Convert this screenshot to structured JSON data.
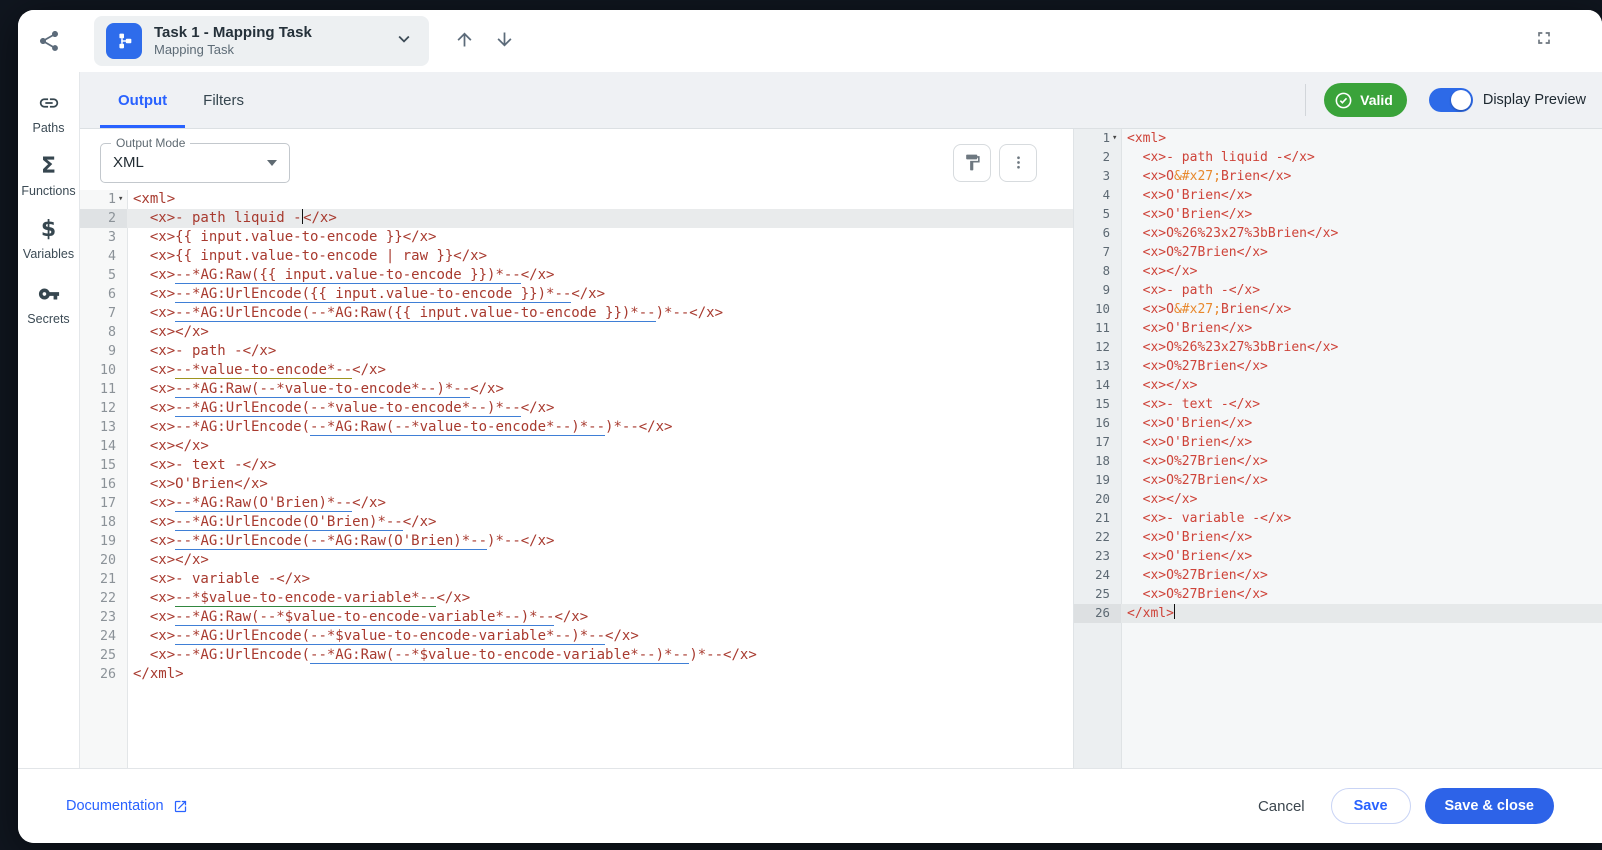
{
  "topbar": {
    "task_title": "Task 1 - Mapping Task",
    "task_subtitle": "Mapping Task"
  },
  "sidebar": {
    "items": [
      {
        "label": "Paths",
        "icon": "link-icon"
      },
      {
        "label": "Functions",
        "icon": "sigma-icon"
      },
      {
        "label": "Variables",
        "icon": "dollar-icon"
      },
      {
        "label": "Secrets",
        "icon": "key-icon"
      }
    ]
  },
  "tabs": [
    {
      "label": "Output",
      "active": true
    },
    {
      "label": "Filters",
      "active": false
    }
  ],
  "status": {
    "valid_label": "Valid"
  },
  "display_preview_label": "Display Preview",
  "output_mode": {
    "label": "Output Mode",
    "value": "XML"
  },
  "colors": {
    "accent_blue": "#2962ff",
    "valid_green": "#3aa33a",
    "editor_code_red": "#a83a2f",
    "preview_code_red": "#ce4339",
    "entity_orange": "#e8882c",
    "underline_blue": "#3f7fd6",
    "underline_olive": "#9e941f",
    "underline_green": "#31873f"
  },
  "editor": {
    "active_line": 2,
    "lines": [
      {
        "fold": true,
        "segs": [
          [
            "<xml>",
            ""
          ]
        ]
      },
      {
        "segs": [
          [
            "  <x>- path liquid -",
            ""
          ],
          [
            "",
            "c"
          ],
          [
            "</x>",
            ""
          ]
        ]
      },
      {
        "segs": [
          [
            "  <x>{{ input.value-to-encode }}</x>",
            ""
          ]
        ]
      },
      {
        "segs": [
          [
            "  <x>{{ input.value-to-encode | raw }}</x>",
            ""
          ]
        ]
      },
      {
        "segs": [
          [
            "  <x>",
            ""
          ],
          [
            "--*AG:Raw({{ input.value-to-encode }})*--",
            "b"
          ],
          [
            "</x>",
            ""
          ]
        ]
      },
      {
        "segs": [
          [
            "  <x>",
            ""
          ],
          [
            "--*AG:UrlEncode({{ input.value-to-encode }})*--",
            "b"
          ],
          [
            "</x>",
            ""
          ]
        ]
      },
      {
        "segs": [
          [
            "  <x>",
            ""
          ],
          [
            "--*AG:UrlEncode(--*AG:Raw({{ input.value-to-encode }})*--",
            "b"
          ],
          [
            ")*--</x>",
            ""
          ]
        ]
      },
      {
        "segs": [
          [
            "  <x></x>",
            ""
          ]
        ]
      },
      {
        "segs": [
          [
            "  <x>- path -</x>",
            ""
          ]
        ]
      },
      {
        "segs": [
          [
            "  <x>",
            ""
          ],
          [
            "--*value-to-encode*--",
            "o"
          ],
          [
            "</x>",
            ""
          ]
        ]
      },
      {
        "segs": [
          [
            "  <x>",
            ""
          ],
          [
            "--*AG:Raw(--*value-to-encode*--)*--",
            "b"
          ],
          [
            "</x>",
            ""
          ]
        ]
      },
      {
        "segs": [
          [
            "  <x>",
            ""
          ],
          [
            "--*AG:UrlEncode(--*value-to-encode*--)*--",
            "b"
          ],
          [
            "</x>",
            ""
          ]
        ]
      },
      {
        "segs": [
          [
            "  <x>--*AG:UrlEncode(",
            ""
          ],
          [
            "--*AG:Raw(--*value-to-encode*--)*--",
            "b"
          ],
          [
            ")*--</x>",
            ""
          ]
        ]
      },
      {
        "segs": [
          [
            "  <x></x>",
            ""
          ]
        ]
      },
      {
        "segs": [
          [
            "  <x>- text -</x>",
            ""
          ]
        ]
      },
      {
        "segs": [
          [
            "  <x>O'Brien</x>",
            ""
          ]
        ]
      },
      {
        "segs": [
          [
            "  <x>",
            ""
          ],
          [
            "--*AG:Raw(O'Brien)*--",
            "b"
          ],
          [
            "</x>",
            ""
          ]
        ]
      },
      {
        "segs": [
          [
            "  <x>",
            ""
          ],
          [
            "--*AG:UrlEncode(O'Brien)*--",
            "b"
          ],
          [
            "</x>",
            ""
          ]
        ]
      },
      {
        "segs": [
          [
            "  <x>",
            ""
          ],
          [
            "--*AG:UrlEncode(--*AG:Raw(O'Brien)*--",
            "b"
          ],
          [
            ")*--</x>",
            ""
          ]
        ]
      },
      {
        "segs": [
          [
            "  <x></x>",
            ""
          ]
        ]
      },
      {
        "segs": [
          [
            "  <x>- variable -</x>",
            ""
          ]
        ]
      },
      {
        "segs": [
          [
            "  <x>",
            ""
          ],
          [
            "--*$value-to-encode-variable*--",
            "g"
          ],
          [
            "</x>",
            ""
          ]
        ]
      },
      {
        "segs": [
          [
            "  <x>",
            ""
          ],
          [
            "--*AG:Raw(--*$value-to-encode-variable*--)*--",
            "b"
          ],
          [
            "</x>",
            ""
          ]
        ]
      },
      {
        "segs": [
          [
            "  <x>",
            ""
          ],
          [
            "--*AG:UrlEncode(--*$value-to-encode-variable*--)*--",
            "b"
          ],
          [
            "</x>",
            ""
          ]
        ]
      },
      {
        "segs": [
          [
            "  <x>--*AG:UrlEncode(",
            ""
          ],
          [
            "--*AG:Raw(--*$value-to-encode-variable*--)*--",
            "b"
          ],
          [
            ")*--</x>",
            ""
          ]
        ]
      },
      {
        "segs": [
          [
            "</xml>",
            ""
          ]
        ]
      }
    ]
  },
  "preview": {
    "active_line": 26,
    "lines": [
      {
        "fold": true,
        "segs": [
          [
            "<xml>",
            ""
          ]
        ]
      },
      {
        "segs": [
          [
            "  <x>- path liquid -</x>",
            ""
          ]
        ]
      },
      {
        "segs": [
          [
            "  <x>O",
            ""
          ],
          [
            "&#x27;",
            "e"
          ],
          [
            "Brien</x>",
            ""
          ]
        ]
      },
      {
        "segs": [
          [
            "  <x>O'Brien</x>",
            ""
          ]
        ]
      },
      {
        "segs": [
          [
            "  <x>O'Brien</x>",
            ""
          ]
        ]
      },
      {
        "segs": [
          [
            "  <x>O%26%23x27%3bBrien</x>",
            ""
          ]
        ]
      },
      {
        "segs": [
          [
            "  <x>O%27Brien</x>",
            ""
          ]
        ]
      },
      {
        "segs": [
          [
            "  <x></x>",
            ""
          ]
        ]
      },
      {
        "segs": [
          [
            "  <x>- path -</x>",
            ""
          ]
        ]
      },
      {
        "segs": [
          [
            "  <x>O",
            ""
          ],
          [
            "&#x27;",
            "e"
          ],
          [
            "Brien</x>",
            ""
          ]
        ]
      },
      {
        "segs": [
          [
            "  <x>O'Brien</x>",
            ""
          ]
        ]
      },
      {
        "segs": [
          [
            "  <x>O%26%23x27%3bBrien</x>",
            ""
          ]
        ]
      },
      {
        "segs": [
          [
            "  <x>O%27Brien</x>",
            ""
          ]
        ]
      },
      {
        "segs": [
          [
            "  <x></x>",
            ""
          ]
        ]
      },
      {
        "segs": [
          [
            "  <x>- text -</x>",
            ""
          ]
        ]
      },
      {
        "segs": [
          [
            "  <x>O'Brien</x>",
            ""
          ]
        ]
      },
      {
        "segs": [
          [
            "  <x>O'Brien</x>",
            ""
          ]
        ]
      },
      {
        "segs": [
          [
            "  <x>O%27Brien</x>",
            ""
          ]
        ]
      },
      {
        "segs": [
          [
            "  <x>O%27Brien</x>",
            ""
          ]
        ]
      },
      {
        "segs": [
          [
            "  <x></x>",
            ""
          ]
        ]
      },
      {
        "segs": [
          [
            "  <x>- variable -</x>",
            ""
          ]
        ]
      },
      {
        "segs": [
          [
            "  <x>O'Brien</x>",
            ""
          ]
        ]
      },
      {
        "segs": [
          [
            "  <x>O'Brien</x>",
            ""
          ]
        ]
      },
      {
        "segs": [
          [
            "  <x>O%27Brien</x>",
            ""
          ]
        ]
      },
      {
        "segs": [
          [
            "  <x>O%27Brien</x>",
            ""
          ]
        ]
      },
      {
        "segs": [
          [
            "</xml>",
            ""
          ],
          [
            "",
            "c"
          ]
        ]
      }
    ]
  },
  "footer": {
    "documentation_label": "Documentation",
    "cancel_label": "Cancel",
    "save_label": "Save",
    "save_close_label": "Save & close"
  }
}
